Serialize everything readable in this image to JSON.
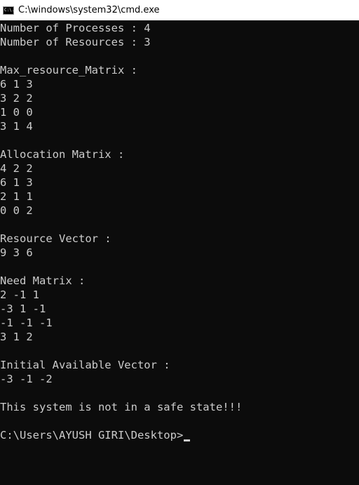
{
  "window": {
    "title": "C:\\windows\\system32\\cmd.exe",
    "icon": "cmd-icon",
    "icon_text": "C:\\."
  },
  "console": {
    "lines": [
      "Number of Processes : 4",
      "Number of Resources : 3",
      "",
      "Max_resource_Matrix :",
      "6 1 3",
      "3 2 2",
      "1 0 0",
      "3 1 4",
      "",
      "Allocation Matrix :",
      "4 2 2",
      "6 1 3",
      "2 1 1",
      "0 0 2",
      "",
      "Resource Vector :",
      "9 3 6",
      "",
      "Need Matrix :",
      "2 -1 1",
      "-3 1 -1",
      "-1 -1 -1",
      "3 1 2",
      "",
      "Initial Available Vector :",
      "-3 -1 -2",
      "",
      "This system is not in a safe state!!!",
      ""
    ],
    "prompt": "C:\\Users\\AYUSH GIRI\\Desktop>"
  },
  "colors": {
    "background": "#0c0c0c",
    "text": "#cccccc",
    "titlebar": "#ffffff"
  }
}
